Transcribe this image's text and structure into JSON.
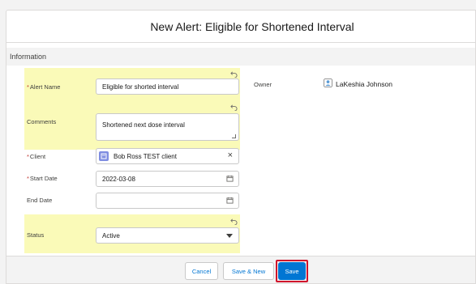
{
  "modal": {
    "title": "New Alert: Eligible for Shortened Interval"
  },
  "section": {
    "title": "Information"
  },
  "fields": {
    "alert_name": {
      "label": "Alert Name",
      "value": "Eligible for shorted interval"
    },
    "comments": {
      "label": "Comments",
      "value": "Shortened next dose interval"
    },
    "client": {
      "label": "Client",
      "value": "Bob Ross TEST client"
    },
    "start_date": {
      "label": "Start Date",
      "value": "2022-03-08"
    },
    "end_date": {
      "label": "End Date",
      "value": ""
    },
    "status": {
      "label": "Status",
      "value": "Active"
    }
  },
  "owner": {
    "label": "Owner",
    "value": "LaKeshia Johnson"
  },
  "buttons": {
    "cancel": "Cancel",
    "save_new": "Save & New",
    "save": "Save"
  },
  "colors": {
    "highlight": "#fafab8",
    "brand": "#0176d3",
    "required": "#c23934",
    "save_outline": "#d0112b"
  },
  "icons": [
    "undo-icon",
    "calendar-icon",
    "client-record-icon",
    "close-icon",
    "dropdown-arrow-icon",
    "owner-user-icon",
    "textarea-resize-icon"
  ]
}
